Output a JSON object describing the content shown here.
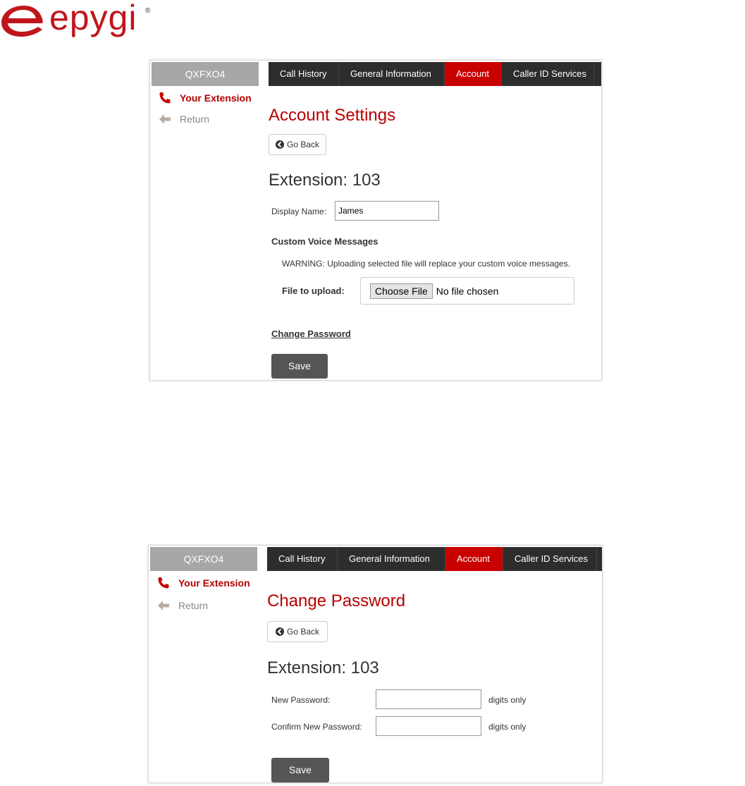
{
  "logo": {
    "text": "epygi",
    "reg": "®"
  },
  "account_page": {
    "device": "QXFXO4",
    "tabs": [
      "Call History",
      "General Information",
      "Account",
      "Caller ID Services"
    ],
    "active_tab": "Account",
    "sidebar": {
      "your_extension": "Your Extension",
      "return": "Return"
    },
    "title": "Account Settings",
    "go_back": "Go Back",
    "extension": "Extension: 103",
    "display_name_label": "Display Name:",
    "display_name_value": "James",
    "custom_voice_heading": "Custom Voice Messages",
    "warning": "WARNING: Uploading selected file will replace your custom voice messages.",
    "file_label": "File to upload:",
    "choose_file": "Choose File",
    "no_file": "No file chosen",
    "change_password_link": "Change Password",
    "save": "Save"
  },
  "password_page": {
    "device": "QXFXO4",
    "tabs": [
      "Call History",
      "General Information",
      "Account",
      "Caller ID Services"
    ],
    "active_tab": "Account",
    "sidebar": {
      "your_extension": "Your Extension",
      "return": "Return"
    },
    "title": "Change Password",
    "go_back": "Go Back",
    "extension": "Extension: 103",
    "new_password_label": "New Password:",
    "confirm_password_label": "Confirm New Password:",
    "digits_only": "digits only",
    "save": "Save"
  },
  "colors": {
    "brand": "#c0161b",
    "active_tab": "#c80000",
    "tab_bar": "#2d2d2d",
    "device_bar": "#a7a7a7",
    "title": "#b80000"
  }
}
